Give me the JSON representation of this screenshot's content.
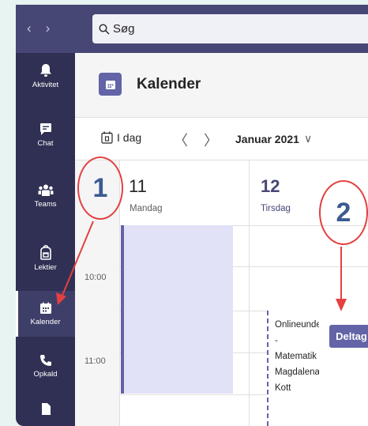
{
  "search": {
    "placeholder": "Søg"
  },
  "rail": {
    "items": [
      {
        "label": "Aktivitet",
        "icon": "bell-icon"
      },
      {
        "label": "Chat",
        "icon": "chat-icon"
      },
      {
        "label": "Teams",
        "icon": "teams-icon"
      },
      {
        "label": "Lektier",
        "icon": "backpack-icon"
      },
      {
        "label": "Kalender",
        "icon": "calendar-icon",
        "active": true
      },
      {
        "label": "Opkald",
        "icon": "phone-icon"
      }
    ]
  },
  "header": {
    "title": "Kalender"
  },
  "toolbar": {
    "today_label": "I dag",
    "month_label": "Januar 2021"
  },
  "days": [
    {
      "number": "11",
      "name": "Mandag"
    },
    {
      "number": "12",
      "name": "Tirsdag",
      "today": true
    }
  ],
  "times": [
    "10:00",
    "11:00"
  ],
  "event": {
    "lines": [
      "Onlineundervisning",
      "-",
      "Matematik",
      "Magdalena",
      "Kott"
    ],
    "join_label": "Deltag"
  },
  "annotations": [
    "1",
    "2"
  ],
  "colors": {
    "brand": "#6264a7",
    "topbar": "#464775",
    "rail": "#2f3053",
    "annotation": "#e34040"
  }
}
